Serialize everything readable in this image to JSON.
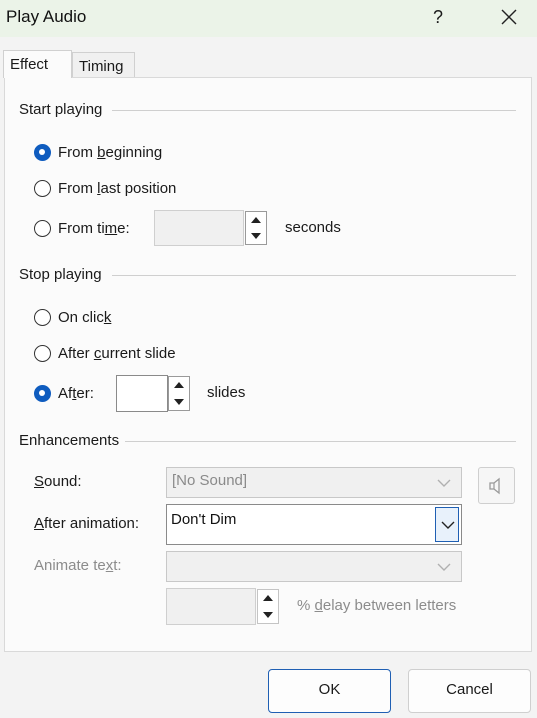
{
  "window": {
    "title": "Play Audio",
    "help_label": "?"
  },
  "tabs": [
    {
      "label": "Effect",
      "active": true
    },
    {
      "label": "Timing",
      "active": false
    }
  ],
  "start_playing": {
    "heading": "Start playing",
    "options": [
      {
        "pre": "From ",
        "u": "b",
        "post": "eginning",
        "selected": true
      },
      {
        "pre": "From ",
        "u": "l",
        "post": "ast position",
        "selected": false
      },
      {
        "pre": "From ti",
        "u": "m",
        "post": "e:",
        "selected": false
      }
    ],
    "time_value": "",
    "time_unit": "seconds"
  },
  "stop_playing": {
    "heading": "Stop playing",
    "options": [
      {
        "pre": "On clic",
        "u": "k",
        "post": "",
        "selected": false
      },
      {
        "pre": "After ",
        "u": "c",
        "post": "urrent slide",
        "selected": false
      },
      {
        "pre": "Af",
        "u": "t",
        "post": "er:",
        "selected": true
      }
    ],
    "slides_value": "",
    "slides_unit": "slides"
  },
  "enhancements": {
    "heading": "Enhancements",
    "sound": {
      "pre": "",
      "u": "S",
      "post": "ound:",
      "value": "[No Sound]"
    },
    "after_animation": {
      "pre": "",
      "u": "A",
      "post": "fter animation:",
      "value": "Don't Dim"
    },
    "animate_text": {
      "pre": "Animate te",
      "u": "x",
      "post": "t:",
      "value": ""
    },
    "delay": {
      "value": "",
      "pre": "% ",
      "u": "d",
      "post": "elay between letters"
    }
  },
  "buttons": {
    "ok": "OK",
    "cancel": "Cancel"
  },
  "colors": {
    "accent": "#0f5cbf",
    "titlebar": "#ebf3e8"
  }
}
